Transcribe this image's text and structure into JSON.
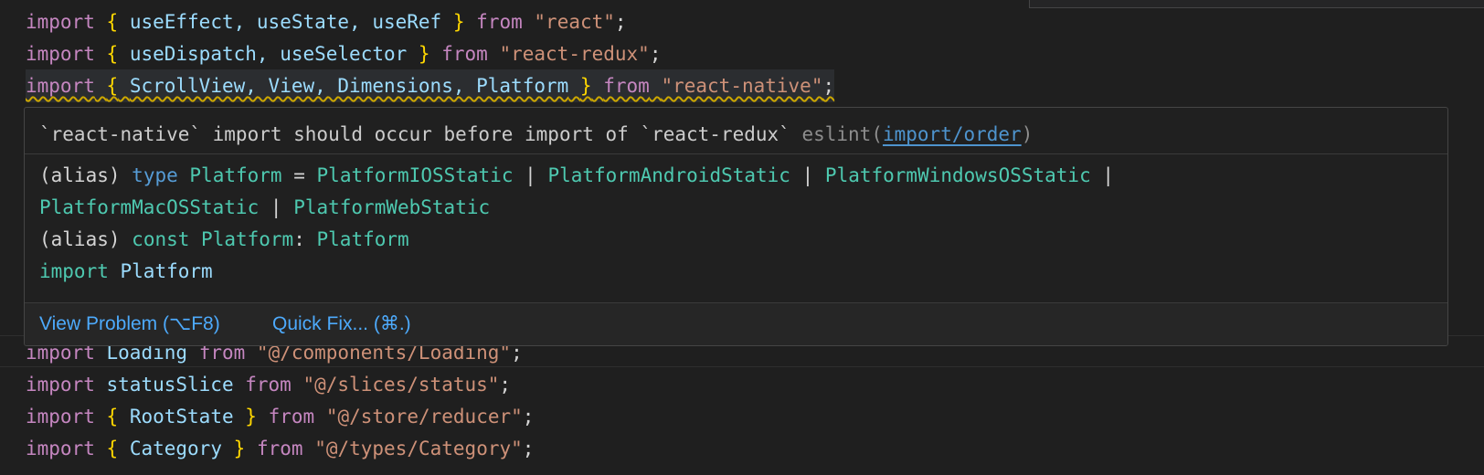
{
  "editor": {
    "lines": [
      {
        "kw": "import",
        "ob": "{",
        "ids": "useEffect, useState, useRef",
        "cb": "}",
        "from": "from",
        "src": "\"react\"",
        "end": ";"
      },
      {
        "kw": "import",
        "ob": "{",
        "ids": "useDispatch, useSelector",
        "cb": "}",
        "from": "from",
        "src": "\"react-redux\"",
        "end": ";"
      },
      {
        "kw": "import",
        "ob": "{",
        "ids": "ScrollView, View, Dimensions, Platform",
        "cb": "}",
        "from": "from",
        "src": "\"react-native\"",
        "end": ";"
      },
      {
        "kw": "import",
        "name": "Loading",
        "from": "from",
        "src": "\"@/components/Loading\"",
        "end": ";"
      },
      {
        "kw": "import",
        "name": "statusSlice",
        "from": "from",
        "src": "\"@/slices/status\"",
        "end": ";"
      },
      {
        "kw": "import",
        "ob": "{",
        "ids": "RootState",
        "cb": "}",
        "from": "from",
        "src": "\"@/store/reducer\"",
        "end": ";"
      },
      {
        "kw": "import",
        "ob": "{",
        "ids": "Category",
        "cb": "}",
        "from": "from",
        "src": "\"@/types/Category\"",
        "end": ";"
      }
    ]
  },
  "hover": {
    "message": "`react-native` import should occur before import of `react-redux`",
    "source": "eslint(",
    "rule": "import/order",
    "source_close": ")",
    "type_alias_prefix": "(alias)",
    "type_keyword": "type",
    "type_name": "Platform",
    "eq": "=",
    "union_1": "PlatformIOSStatic",
    "union_2": "PlatformAndroidStatic",
    "union_3": "PlatformWindowsOSStatic",
    "union_4": "PlatformMacOSStatic",
    "union_5": "PlatformWebStatic",
    "pipe": "|",
    "const_alias_prefix": "(alias)",
    "const_keyword": "const",
    "const_name": "Platform",
    "colon": ":",
    "const_type": "Platform",
    "import_keyword": "import",
    "import_name": "Platform",
    "view_problem": "View Problem (⌥F8)",
    "quick_fix": "Quick Fix... (⌘.)"
  },
  "colors": {
    "keyword": "#c586c0",
    "bracket": "#ffd700",
    "identifier": "#9cdcfe",
    "string": "#ce9178",
    "type": "#4ec9b0",
    "warning_squiggle": "#cca700",
    "link": "#4daafc"
  }
}
